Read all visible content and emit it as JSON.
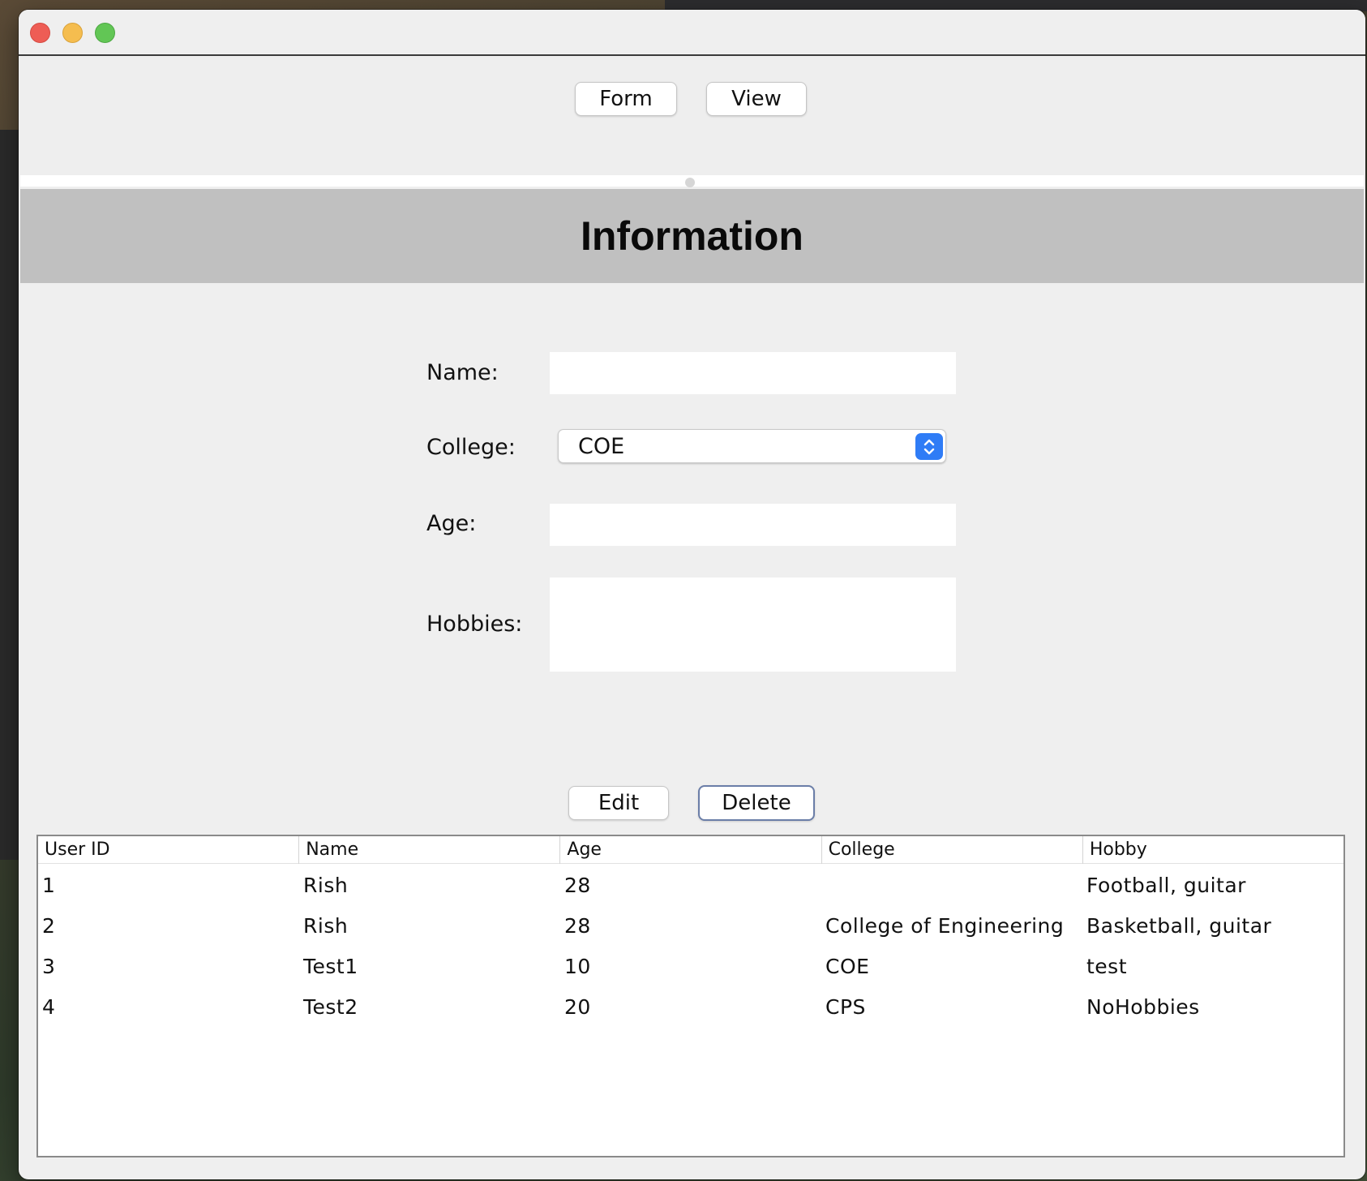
{
  "nav": {
    "form_label": "Form",
    "view_label": "View"
  },
  "header": {
    "title": "Information"
  },
  "form": {
    "name_label": "Name:",
    "name_value": "",
    "college_label": "College:",
    "college_selected": "COE",
    "age_label": "Age:",
    "age_value": "",
    "hobbies_label": "Hobbies:",
    "hobbies_value": ""
  },
  "actions": {
    "edit_label": "Edit",
    "delete_label": "Delete"
  },
  "table": {
    "columns": [
      "User ID",
      "Name",
      "Age",
      "College",
      "Hobby"
    ],
    "rows": [
      [
        "1",
        "Rish",
        "28",
        "",
        "Football, guitar"
      ],
      [
        "2",
        "Rish",
        "28",
        "College of Engineering",
        "Basketball, guitar"
      ],
      [
        "3",
        "Test1",
        "10",
        "COE",
        "test"
      ],
      [
        "4",
        "Test2",
        "20",
        "CPS",
        "NoHobbies"
      ]
    ]
  },
  "colors": {
    "window_bg": "#efefef",
    "header_band": "#c0c0c0",
    "select_accent": "#2f7cf6",
    "close_light": "#ee5d55",
    "minimize_light": "#f5bd4f",
    "maximize_light": "#62c655"
  }
}
